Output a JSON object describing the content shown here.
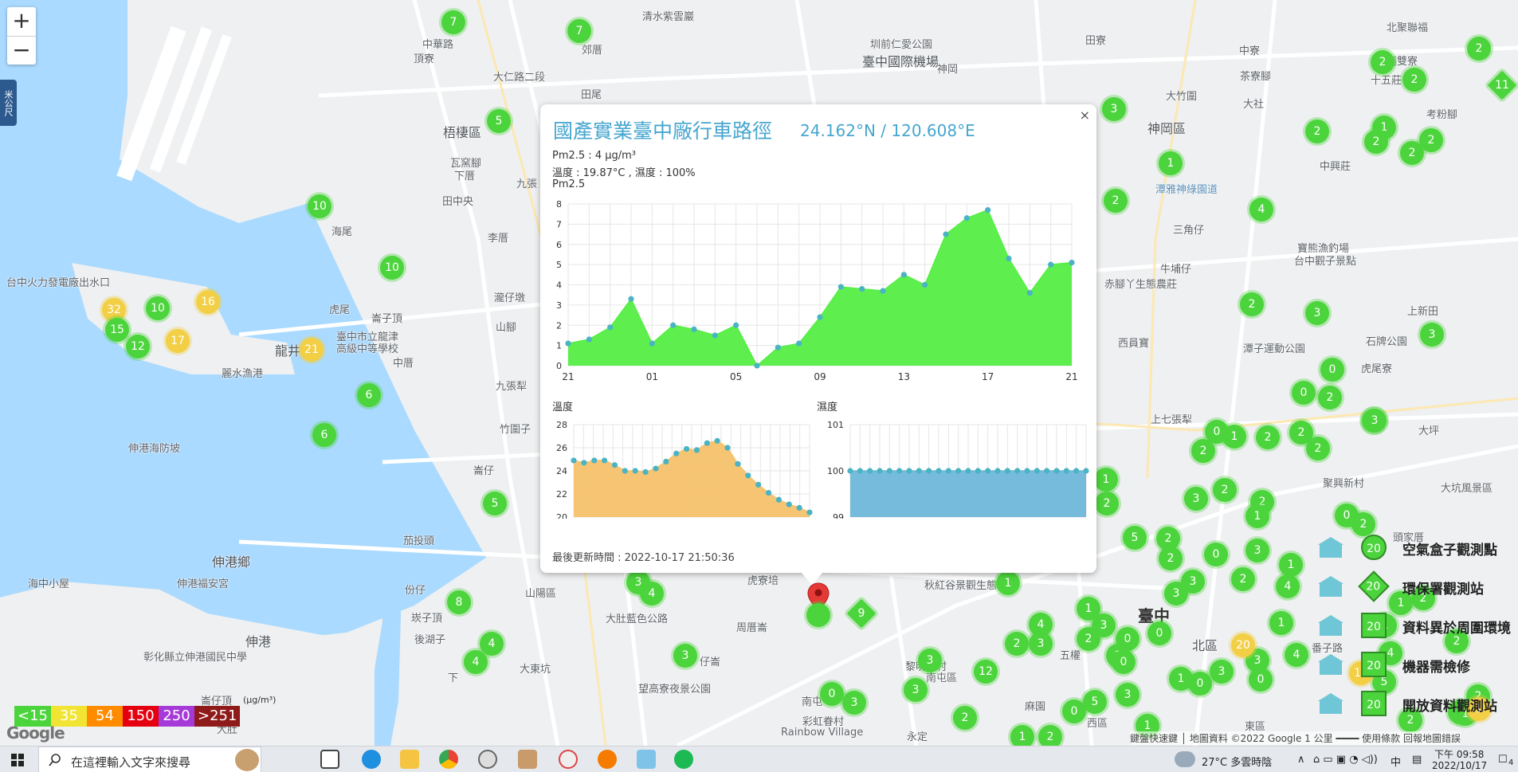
{
  "zoom": {
    "in": "+",
    "out": "−"
  },
  "menu_tab": "米公尺",
  "map_labels": [
    {
      "t": "清水紫雲巖",
      "x": 806,
      "y": 10
    },
    {
      "t": "臺中國際機場",
      "x": 1082,
      "y": 64,
      "c": "big"
    },
    {
      "t": "圳前仁愛公園",
      "x": 1092,
      "y": 45
    },
    {
      "t": "神岡",
      "x": 1176,
      "y": 76
    },
    {
      "t": "田寮",
      "x": 1362,
      "y": 40
    },
    {
      "t": "中寮",
      "x": 1555,
      "y": 53
    },
    {
      "t": "北聚聯福",
      "x": 1740,
      "y": 24
    },
    {
      "t": "南雙寮",
      "x": 1740,
      "y": 66
    },
    {
      "t": "十五莊",
      "x": 1720,
      "y": 90
    },
    {
      "t": "茶寮腳",
      "x": 1556,
      "y": 85
    },
    {
      "t": "大竹圍",
      "x": 1463,
      "y": 110
    },
    {
      "t": "大社",
      "x": 1560,
      "y": 120
    },
    {
      "t": "考粉腳",
      "x": 1790,
      "y": 133
    },
    {
      "t": "神岡區",
      "x": 1440,
      "y": 148,
      "c": "big"
    },
    {
      "t": "中興莊",
      "x": 1656,
      "y": 198
    },
    {
      "t": "潭雅神綠園道",
      "x": 1450,
      "y": 227,
      "c": "blue"
    },
    {
      "t": "三角仔",
      "x": 1472,
      "y": 278
    },
    {
      "t": "寶熊漁釣場",
      "x": 1628,
      "y": 301
    },
    {
      "t": "台中觀子景點",
      "x": 1624,
      "y": 317
    },
    {
      "t": "牛埔仔",
      "x": 1456,
      "y": 327
    },
    {
      "t": "赤腳丫生態農莊",
      "x": 1386,
      "y": 346
    },
    {
      "t": "上新田",
      "x": 1766,
      "y": 380
    },
    {
      "t": "西員寶",
      "x": 1403,
      "y": 420
    },
    {
      "t": "潭子運動公園",
      "x": 1560,
      "y": 427
    },
    {
      "t": "石牌公園",
      "x": 1714,
      "y": 418
    },
    {
      "t": "虎尾寮",
      "x": 1708,
      "y": 452
    },
    {
      "t": "上七張犁",
      "x": 1444,
      "y": 516
    },
    {
      "t": "大坪",
      "x": 1780,
      "y": 530
    },
    {
      "t": "聚興新村",
      "x": 1660,
      "y": 596
    },
    {
      "t": "大坑風景區",
      "x": 1808,
      "y": 602
    },
    {
      "t": "頭家厝",
      "x": 1748,
      "y": 664
    },
    {
      "t": "臺中",
      "x": 1428,
      "y": 757,
      "c": "bold"
    },
    {
      "t": "北區",
      "x": 1496,
      "y": 797,
      "c": "big"
    },
    {
      "t": "東區",
      "x": 1562,
      "y": 901
    },
    {
      "t": "番子路",
      "x": 1646,
      "y": 803
    },
    {
      "t": "南屯",
      "x": 1006,
      "y": 870
    },
    {
      "t": "西區",
      "x": 1364,
      "y": 897
    },
    {
      "t": "彩虹眷村",
      "x": 1007,
      "y": 895
    },
    {
      "t": "Rainbow Village",
      "x": 980,
      "y": 912
    },
    {
      "t": "永定",
      "x": 1138,
      "y": 914
    },
    {
      "t": "黎明新村",
      "x": 1136,
      "y": 826
    },
    {
      "t": "南屯區",
      "x": 1162,
      "y": 840
    },
    {
      "t": "麻園",
      "x": 1286,
      "y": 876
    },
    {
      "t": "秋紅谷景觀生態",
      "x": 1160,
      "y": 724
    },
    {
      "t": "五權",
      "x": 1330,
      "y": 812
    },
    {
      "t": "田尾",
      "x": 729,
      "y": 108
    },
    {
      "t": "郊厝",
      "x": 730,
      "y": 52
    },
    {
      "t": "頂寮",
      "x": 519,
      "y": 63
    },
    {
      "t": "梧棲區",
      "x": 556,
      "y": 153,
      "c": "big"
    },
    {
      "t": "瓦窯腳",
      "x": 565,
      "y": 194
    },
    {
      "t": "下厝",
      "x": 570,
      "y": 210
    },
    {
      "t": "田中央",
      "x": 555,
      "y": 242
    },
    {
      "t": "海尾",
      "x": 416,
      "y": 280
    },
    {
      "t": "虎尾",
      "x": 413,
      "y": 378
    },
    {
      "t": "崙子頂",
      "x": 466,
      "y": 389
    },
    {
      "t": "龍井",
      "x": 345,
      "y": 427,
      "c": "big"
    },
    {
      "t": "臺中市立龍津",
      "x": 422,
      "y": 412
    },
    {
      "t": "高級中等學校",
      "x": 422,
      "y": 427
    },
    {
      "t": "中厝",
      "x": 493,
      "y": 445
    },
    {
      "t": "麗水漁港",
      "x": 278,
      "y": 458
    },
    {
      "t": "台中火力發電廠出水口",
      "x": 8,
      "y": 344
    },
    {
      "t": "伸港海防坡",
      "x": 161,
      "y": 552
    },
    {
      "t": "伸港鄉",
      "x": 266,
      "y": 692,
      "c": "big"
    },
    {
      "t": "伸港福安宮",
      "x": 222,
      "y": 722
    },
    {
      "t": "海中小屋",
      "x": 35,
      "y": 722
    },
    {
      "t": "伸港",
      "x": 308,
      "y": 792,
      "c": "big"
    },
    {
      "t": "彰化縣立伸港國民中學",
      "x": 180,
      "y": 814
    },
    {
      "t": "崙仔頂",
      "x": 252,
      "y": 869
    },
    {
      "t": "大肚",
      "x": 272,
      "y": 905
    },
    {
      "t": "茄投頭",
      "x": 506,
      "y": 668
    },
    {
      "t": "份仔",
      "x": 508,
      "y": 730
    },
    {
      "t": "崁子頂",
      "x": 516,
      "y": 765
    },
    {
      "t": "後湖子",
      "x": 520,
      "y": 792
    },
    {
      "t": "下",
      "x": 562,
      "y": 840
    },
    {
      "t": "大東坑",
      "x": 652,
      "y": 829
    },
    {
      "t": "山陽區",
      "x": 659,
      "y": 734
    },
    {
      "t": "大肚藍色公路",
      "x": 760,
      "y": 766
    },
    {
      "t": "望高寮夜景公園",
      "x": 801,
      "y": 854
    },
    {
      "t": "仔崙",
      "x": 878,
      "y": 820
    },
    {
      "t": "南屯",
      "x": 1006,
      "y": 870
    },
    {
      "t": "周厝崙",
      "x": 924,
      "y": 777
    },
    {
      "t": "虎寮培",
      "x": 938,
      "y": 718
    },
    {
      "t": "李厝",
      "x": 612,
      "y": 288
    },
    {
      "t": "瀧仔墩",
      "x": 620,
      "y": 363
    },
    {
      "t": "山腳",
      "x": 622,
      "y": 400
    },
    {
      "t": "九張犁",
      "x": 622,
      "y": 474
    },
    {
      "t": "竹圍子",
      "x": 627,
      "y": 528
    },
    {
      "t": "崙仔",
      "x": 594,
      "y": 580
    },
    {
      "t": "九張",
      "x": 648,
      "y": 220
    },
    {
      "t": "大仁路二段",
      "x": 619,
      "y": 86
    },
    {
      "t": "中華路",
      "x": 530,
      "y": 45
    }
  ],
  "markers": [
    {
      "v": "7",
      "x": 569,
      "y": 28
    },
    {
      "v": "7",
      "x": 727,
      "y": 39
    },
    {
      "v": "5",
      "x": 626,
      "y": 152
    },
    {
      "v": "10",
      "x": 401,
      "y": 259
    },
    {
      "v": "10",
      "x": 492,
      "y": 336
    },
    {
      "v": "32",
      "x": 143,
      "y": 389,
      "c": "yellow"
    },
    {
      "v": "10",
      "x": 198,
      "y": 387
    },
    {
      "v": "16",
      "x": 261,
      "y": 379,
      "c": "yellow"
    },
    {
      "v": "15",
      "x": 147,
      "y": 414
    },
    {
      "v": "12",
      "x": 173,
      "y": 435
    },
    {
      "v": "17",
      "x": 223,
      "y": 428,
      "c": "yellow"
    },
    {
      "v": "21",
      "x": 391,
      "y": 439,
      "c": "yellow"
    },
    {
      "v": "6",
      "x": 463,
      "y": 496
    },
    {
      "v": "6",
      "x": 407,
      "y": 546
    },
    {
      "v": "5",
      "x": 621,
      "y": 632
    },
    {
      "v": "8",
      "x": 576,
      "y": 756
    },
    {
      "v": "4",
      "x": 617,
      "y": 808
    },
    {
      "v": "4",
      "x": 597,
      "y": 831
    },
    {
      "v": "3",
      "x": 801,
      "y": 731
    },
    {
      "v": "4",
      "x": 818,
      "y": 745
    },
    {
      "v": "3",
      "x": 860,
      "y": 823
    },
    {
      "v": "9",
      "x": 1081,
      "y": 770,
      "c": "diamond"
    },
    {
      "v": "0",
      "x": 1044,
      "y": 871
    },
    {
      "v": "3",
      "x": 1072,
      "y": 882
    },
    {
      "v": "3",
      "x": 1149,
      "y": 866
    },
    {
      "v": "3",
      "x": 1167,
      "y": 829
    },
    {
      "v": "12",
      "x": 1237,
      "y": 843
    },
    {
      "v": "1",
      "x": 1265,
      "y": 732
    },
    {
      "v": "1",
      "x": 1388,
      "y": 602
    },
    {
      "v": "2",
      "x": 1389,
      "y": 632
    },
    {
      "v": "2",
      "x": 1211,
      "y": 901
    },
    {
      "v": "1",
      "x": 1283,
      "y": 925
    },
    {
      "v": "2",
      "x": 1318,
      "y": 925
    },
    {
      "v": "0",
      "x": 1348,
      "y": 893
    },
    {
      "v": "3",
      "x": 1398,
      "y": 137
    },
    {
      "v": "1",
      "x": 1469,
      "y": 205
    },
    {
      "v": "2",
      "x": 1400,
      "y": 252
    },
    {
      "v": "4",
      "x": 1583,
      "y": 263
    },
    {
      "v": "2",
      "x": 1571,
      "y": 382
    },
    {
      "v": "3",
      "x": 1653,
      "y": 393
    },
    {
      "v": "0",
      "x": 1672,
      "y": 464
    },
    {
      "v": "0",
      "x": 1636,
      "y": 493
    },
    {
      "v": "2",
      "x": 1669,
      "y": 499
    },
    {
      "v": "3",
      "x": 1724,
      "y": 528
    },
    {
      "v": "0",
      "x": 1527,
      "y": 542
    },
    {
      "v": "1",
      "x": 1549,
      "y": 548
    },
    {
      "v": "2",
      "x": 1591,
      "y": 549
    },
    {
      "v": "2",
      "x": 1633,
      "y": 543
    },
    {
      "v": "2",
      "x": 1654,
      "y": 563
    },
    {
      "v": "2",
      "x": 1510,
      "y": 566
    },
    {
      "v": "3",
      "x": 1501,
      "y": 626
    },
    {
      "v": "2",
      "x": 1537,
      "y": 615
    },
    {
      "v": "2",
      "x": 1584,
      "y": 630
    },
    {
      "v": "1",
      "x": 1578,
      "y": 648
    },
    {
      "v": "0",
      "x": 1690,
      "y": 647
    },
    {
      "v": "2",
      "x": 1711,
      "y": 658
    },
    {
      "v": "5",
      "x": 1424,
      "y": 675
    },
    {
      "v": "2",
      "x": 1466,
      "y": 676
    },
    {
      "v": "2",
      "x": 1469,
      "y": 701
    },
    {
      "v": "0",
      "x": 1526,
      "y": 696
    },
    {
      "v": "3",
      "x": 1578,
      "y": 691
    },
    {
      "v": "2",
      "x": 1560,
      "y": 727
    },
    {
      "v": "1",
      "x": 1620,
      "y": 709
    },
    {
      "v": "4",
      "x": 1616,
      "y": 736
    },
    {
      "v": "3",
      "x": 1476,
      "y": 745
    },
    {
      "v": "3",
      "x": 1497,
      "y": 730
    },
    {
      "v": "1",
      "x": 1608,
      "y": 782
    },
    {
      "v": "4",
      "x": 1627,
      "y": 822
    },
    {
      "v": "3",
      "x": 1578,
      "y": 829
    },
    {
      "v": "0",
      "x": 1582,
      "y": 853
    },
    {
      "v": "4",
      "x": 1306,
      "y": 784
    },
    {
      "v": "2",
      "x": 1276,
      "y": 808
    },
    {
      "v": "3",
      "x": 1306,
      "y": 808
    },
    {
      "v": "2",
      "x": 1366,
      "y": 802
    },
    {
      "v": "1",
      "x": 1366,
      "y": 764
    },
    {
      "v": "3",
      "x": 1385,
      "y": 785
    },
    {
      "v": "0",
      "x": 1415,
      "y": 802
    },
    {
      "v": "0",
      "x": 1455,
      "y": 795
    },
    {
      "v": "2",
      "x": 1403,
      "y": 823
    },
    {
      "v": "0",
      "x": 1410,
      "y": 831
    },
    {
      "v": "1",
      "x": 1482,
      "y": 852
    },
    {
      "v": "0",
      "x": 1506,
      "y": 858
    },
    {
      "v": "3",
      "x": 1533,
      "y": 843
    },
    {
      "v": "20",
      "x": 1560,
      "y": 810,
      "c": "yellow"
    },
    {
      "v": "3",
      "x": 1415,
      "y": 872
    },
    {
      "v": "5",
      "x": 1374,
      "y": 881
    },
    {
      "v": "1",
      "x": 1440,
      "y": 911
    },
    {
      "v": "2",
      "x": 1770,
      "y": 904
    },
    {
      "v": "0",
      "x": 1832,
      "y": 894
    },
    {
      "v": "2",
      "x": 1855,
      "y": 874
    },
    {
      "v": "2",
      "x": 1735,
      "y": 78
    },
    {
      "v": "2",
      "x": 1775,
      "y": 100
    },
    {
      "v": "1",
      "x": 1737,
      "y": 160
    },
    {
      "v": "2",
      "x": 1727,
      "y": 178
    },
    {
      "v": "2",
      "x": 1772,
      "y": 192
    },
    {
      "v": "2",
      "x": 1796,
      "y": 176
    },
    {
      "v": "2",
      "x": 1653,
      "y": 165
    },
    {
      "v": "2",
      "x": 1856,
      "y": 61
    },
    {
      "v": "11",
      "x": 1885,
      "y": 107,
      "c": "diamond"
    },
    {
      "v": "3",
      "x": 1797,
      "y": 420
    },
    {
      "v": "3",
      "x": 1725,
      "y": 528
    },
    {
      "v": "1",
      "x": 1758,
      "y": 757
    },
    {
      "v": "2",
      "x": 1786,
      "y": 751
    },
    {
      "v": "2",
      "x": 1828,
      "y": 805
    },
    {
      "v": "4",
      "x": 1745,
      "y": 820
    },
    {
      "v": "5",
      "x": 1737,
      "y": 856
    },
    {
      "v": "16",
      "x": 1708,
      "y": 845,
      "c": "yellow"
    },
    {
      "v": "1",
      "x": 1738,
      "y": 785
    },
    {
      "v": "1",
      "x": 1839,
      "y": 896
    },
    {
      "v": "1",
      "x": 1856,
      "y": 890,
      "c": "yellow"
    }
  ],
  "aqi_legend": [
    {
      "label": "<15",
      "color": "#4cd43c"
    },
    {
      "label": "35",
      "color": "#f2e432"
    },
    {
      "label": "54",
      "color": "#ff8c00"
    },
    {
      "label": "150",
      "color": "#e4000f"
    },
    {
      "label": "250",
      "color": "#a63ad9"
    },
    {
      "label": ">251",
      "color": "#8f1a1a"
    }
  ],
  "aqi_unit": "(μg/m³)",
  "google_logo": "Google",
  "site_legend": [
    {
      "label": "空氣盒子觀測點",
      "value": "20",
      "shape": "circle",
      "icon": "airbox-icon"
    },
    {
      "label": "環保署觀測站",
      "value": "20",
      "shape": "diamond",
      "icon": "government-building-icon"
    },
    {
      "label": "資料異於周圍環境",
      "value": "20",
      "shape": "square",
      "icon": "house-alert-icon"
    },
    {
      "label": "機器需檢修",
      "value": "20",
      "shape": "square",
      "icon": "lighthouse-icon"
    },
    {
      "label": "開放資料觀測站",
      "value": "20",
      "shape": "square",
      "icon": "open-data-icon"
    }
  ],
  "attribution": "鍵盤快速鍵 │ 地圖資料 ©2022 Google   1 公里 ━━━━   使用條款   回報地圖錯誤",
  "popup": {
    "close": "×",
    "title": "國產實業臺中廠行車路徑",
    "coord": "24.162°N / 120.608°E",
    "pm25_line": "Pm2.5 : 4 μg/m³",
    "temp_hum_line": "溫度 : 19.87°C , 濕度 : 100%",
    "pm25_label": "Pm2.5",
    "temp_label": "溫度",
    "hum_label": "濕度",
    "last_update": "最後更新時間 : 2022-10-17 21:50:36"
  },
  "chart_data": [
    {
      "type": "area",
      "title": "Pm2.5",
      "x_ticks": [
        "21",
        "01",
        "05",
        "09",
        "13",
        "17",
        "21"
      ],
      "ylim": [
        0,
        8
      ],
      "y_ticks": [
        0,
        1,
        2,
        3,
        4,
        5,
        6,
        7,
        8
      ],
      "grid": true,
      "color": "#55ee44",
      "series": [
        {
          "values": [
            1.1,
            1.3,
            1.9,
            3.3,
            1.1,
            2.0,
            1.8,
            1.5,
            2.0,
            0.0,
            0.9,
            1.1,
            2.4,
            3.9,
            3.8,
            3.7,
            4.5,
            4.0,
            6.5,
            7.3,
            7.7,
            5.3,
            3.6,
            5.0,
            5.1
          ]
        }
      ]
    },
    {
      "type": "area",
      "title": "溫度",
      "ylim": [
        20,
        28
      ],
      "y_ticks": [
        20,
        22,
        24,
        26,
        28
      ],
      "grid": true,
      "color": "#f5c26b",
      "series": [
        {
          "values": [
            24.9,
            24.7,
            24.9,
            24.9,
            24.5,
            24.0,
            24.0,
            23.9,
            24.2,
            24.8,
            25.5,
            25.9,
            25.8,
            26.4,
            26.6,
            26.0,
            24.6,
            23.6,
            22.8,
            22.1,
            21.5,
            21.1,
            20.8,
            20.4
          ]
        }
      ]
    },
    {
      "type": "area",
      "title": "濕度",
      "ylim": [
        99,
        101
      ],
      "y_ticks": [
        99,
        100,
        101
      ],
      "grid": true,
      "color": "#6fb7d9",
      "series": [
        {
          "values": [
            100,
            100,
            100,
            100,
            100,
            100,
            100,
            100,
            100,
            100,
            100,
            100,
            100,
            100,
            100,
            100,
            100,
            100,
            100,
            100,
            100,
            100,
            100,
            100,
            100
          ]
        }
      ]
    }
  ],
  "taskbar": {
    "search_placeholder": "在這裡輸入文字來搜尋",
    "weather": "27°C  多雲時陰",
    "ime": "中",
    "time": "下午 09:58",
    "date": "2022/10/17",
    "notification_count": "4"
  }
}
